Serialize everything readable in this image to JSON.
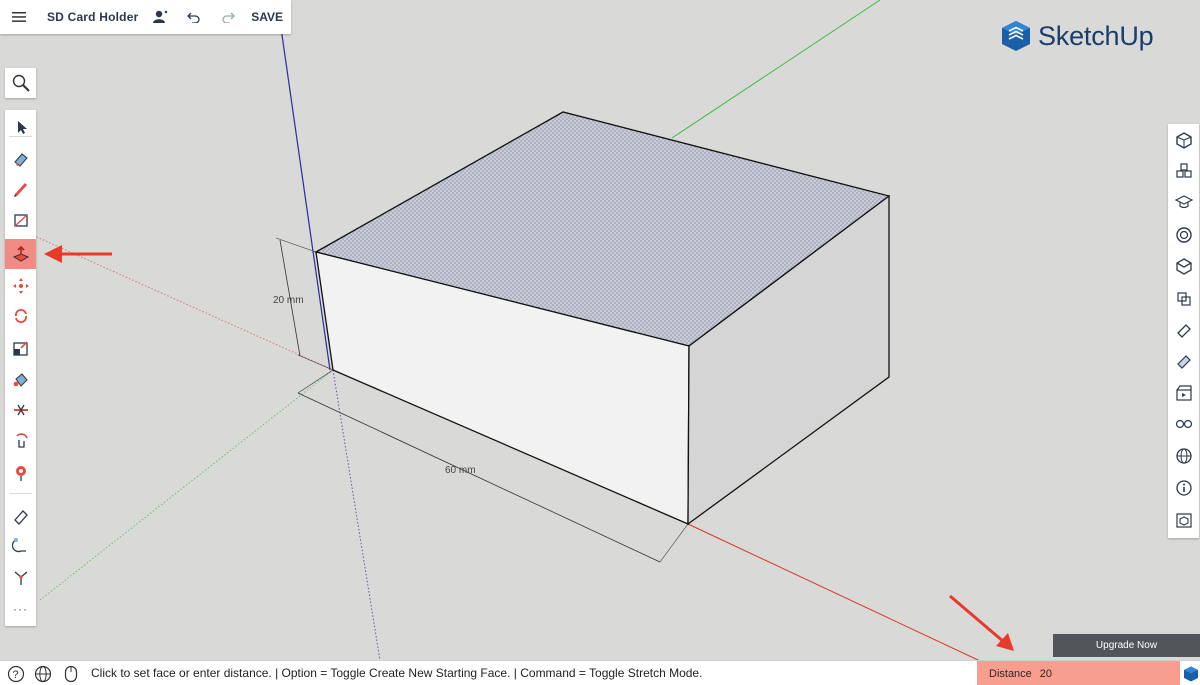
{
  "app": {
    "document_title": "SD Card Holder",
    "save_label": "SAVE",
    "logo_text": "SketchUp"
  },
  "left_toolbar": {
    "search_icon": "search-icon",
    "tools": [
      {
        "name": "select-icon",
        "active": false
      },
      {
        "name": "eraser-icon",
        "active": false
      },
      {
        "name": "pencil-icon",
        "active": false
      },
      {
        "name": "rectangle-icon",
        "active": false
      },
      {
        "name": "push-pull-icon",
        "active": true
      },
      {
        "name": "move-icon",
        "active": false
      },
      {
        "name": "rotate-icon",
        "active": false
      },
      {
        "name": "scale-icon",
        "active": false
      },
      {
        "name": "paint-bucket-icon",
        "active": false
      },
      {
        "name": "section-plane-icon",
        "active": false
      },
      {
        "name": "orbit-icon",
        "active": false
      },
      {
        "name": "position-camera-icon",
        "active": false
      },
      {
        "name": "tape-measure-icon",
        "active": false
      },
      {
        "name": "follow-me-icon",
        "active": false
      },
      {
        "name": "axes-icon",
        "active": false
      }
    ],
    "more_label": "···"
  },
  "right_panel": {
    "icons": [
      "entity-info-icon",
      "components-icon",
      "instructor-icon",
      "materials-icon",
      "styles-icon",
      "outliner-icon",
      "tags-icon",
      "soften-edges-icon",
      "scenes-icon",
      "display-icon",
      "geo-location-icon",
      "model-info-icon",
      "3d-warehouse-icon"
    ]
  },
  "model": {
    "dimension_height": "20 mm",
    "dimension_length": "60 mm"
  },
  "status_bar": {
    "message": "Click to set face or enter distance. | Option = Toggle Create New Starting Face. | Command = Toggle Stretch Mode.",
    "vcb_label": "Distance",
    "vcb_value": "20",
    "upgrade_label": "Upgrade Now"
  },
  "colors": {
    "accent": "#f08c84",
    "vcb_background": "#f79e8e",
    "annotation_arrow": "#e8392b",
    "axis_red": "#d43b2a",
    "axis_green": "#3dbb3d",
    "axis_blue": "#2c2c9c",
    "brand_blue": "#1a3d6b"
  }
}
